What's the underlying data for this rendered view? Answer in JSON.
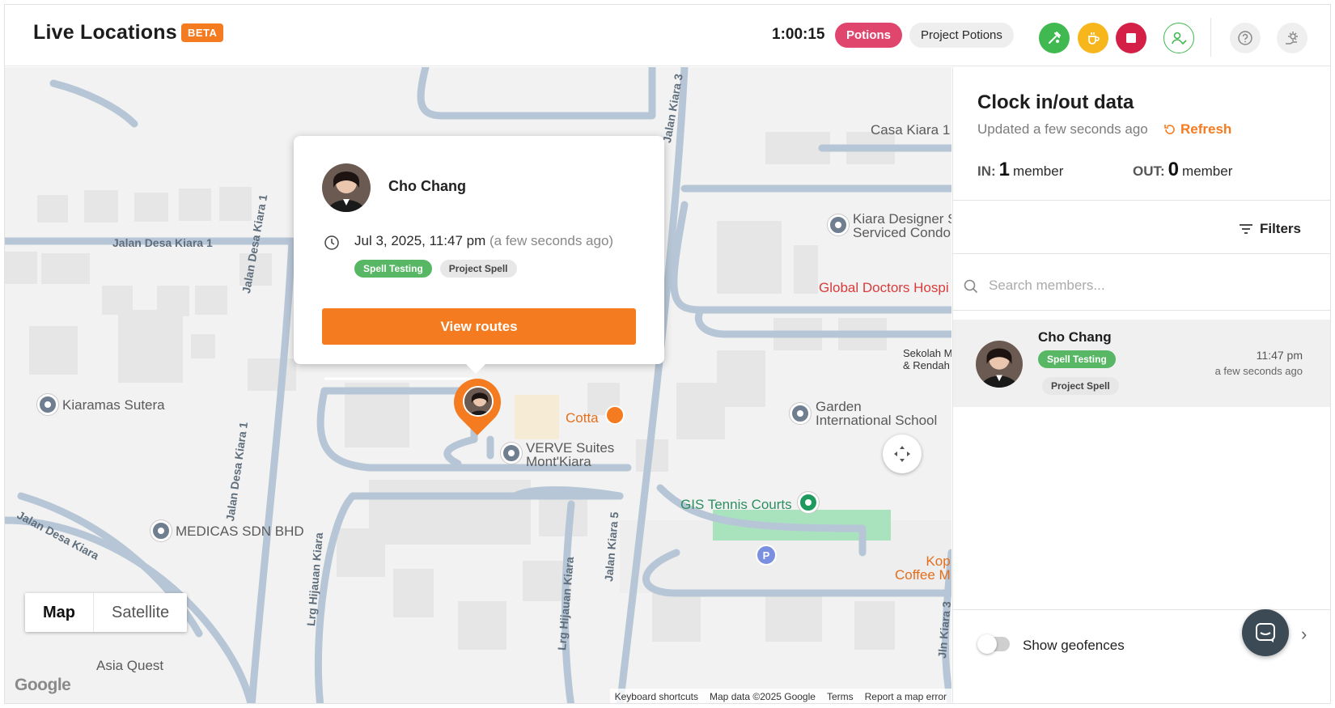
{
  "header": {
    "title": "Live Locations",
    "badge": "BETA",
    "timer": "1:00:15",
    "active_project": "Potions",
    "project_name": "Project Potions"
  },
  "icons": {
    "header_buttons": [
      "tool-icon",
      "coffee-break-icon",
      "stop-icon",
      "user-check-icon",
      "help-icon",
      "settings-icon"
    ]
  },
  "colors": {
    "accent": "#f47b20",
    "potions_pill": "#e0456d",
    "green": "#3fb950",
    "yellow": "#f7b71c",
    "red": "#d42046",
    "tag_green": "#57b764"
  },
  "map": {
    "labels": {
      "casa_kiara": "Casa Kiara 1",
      "kiara_designer_1": "Kiara Designer S",
      "kiara_designer_2": "Serviced Condor",
      "global_doctors": "Global Doctors Hospi",
      "sekolah_1": "Sekolah M",
      "sekolah_2": "& Rendah",
      "kiaramas": "Kiaramas Sutera",
      "cotta": "Cotta",
      "verve_1": "VERVE Suites",
      "verve_2": "Mont'Kiara",
      "garden_1": "Garden",
      "garden_2": "International School",
      "gis_tennis": "GIS Tennis Courts",
      "medicas": "MEDICAS SDN BHD",
      "kop_1": "Kop",
      "kop_2": "Coffee M",
      "asia_quest": "Asia Quest",
      "parking": "P"
    },
    "streets": {
      "desa_kiara_1": "Jalan Desa Kiara 1",
      "desa_kiara_1_v": "Jalan Desa Kiara 1",
      "desa_kiara_1_v2": "Jalan Desa Kiara 1",
      "desa_kiara": "Jalan Desa Kiara",
      "kiara_top": "Jalan Kiara 3",
      "kiara_5": "Jalan Kiara 5",
      "kiara_side": "Jalan Kiara 5",
      "hijauan_1": "Lrg Hijauan Kiara",
      "hijauan_2": "Lrg Hijauan Kiara",
      "kiara_bottom": "Jln Kiara 3",
      "jala": "Jala"
    },
    "popup": {
      "name": "Cho Chang",
      "time": "Jul 3, 2025, 11:47 pm",
      "ago": "(a few seconds ago)",
      "tags": [
        "Spell Testing",
        "Project Spell"
      ],
      "button": "View routes"
    },
    "map_type": {
      "map": "Map",
      "satellite": "Satellite"
    },
    "google": "Google",
    "footer": {
      "shortcuts": "Keyboard shortcuts",
      "data": "Map data ©2025 Google",
      "terms": "Terms",
      "report": "Report a map error"
    }
  },
  "panel": {
    "title": "Clock in/out data",
    "updated": "Updated a few seconds ago",
    "refresh": "Refresh",
    "in_label": "IN:",
    "in_count": "1",
    "in_unit": "member",
    "out_label": "OUT:",
    "out_count": "0",
    "out_unit": "member",
    "filters": "Filters",
    "search_placeholder": "Search members...",
    "members": [
      {
        "name": "Cho Chang",
        "tag": "Spell Testing",
        "project": "Project Spell",
        "time": "11:47 pm",
        "ago": "a few seconds ago"
      }
    ],
    "geofences": "Show geofences",
    "geofences_on": false
  }
}
